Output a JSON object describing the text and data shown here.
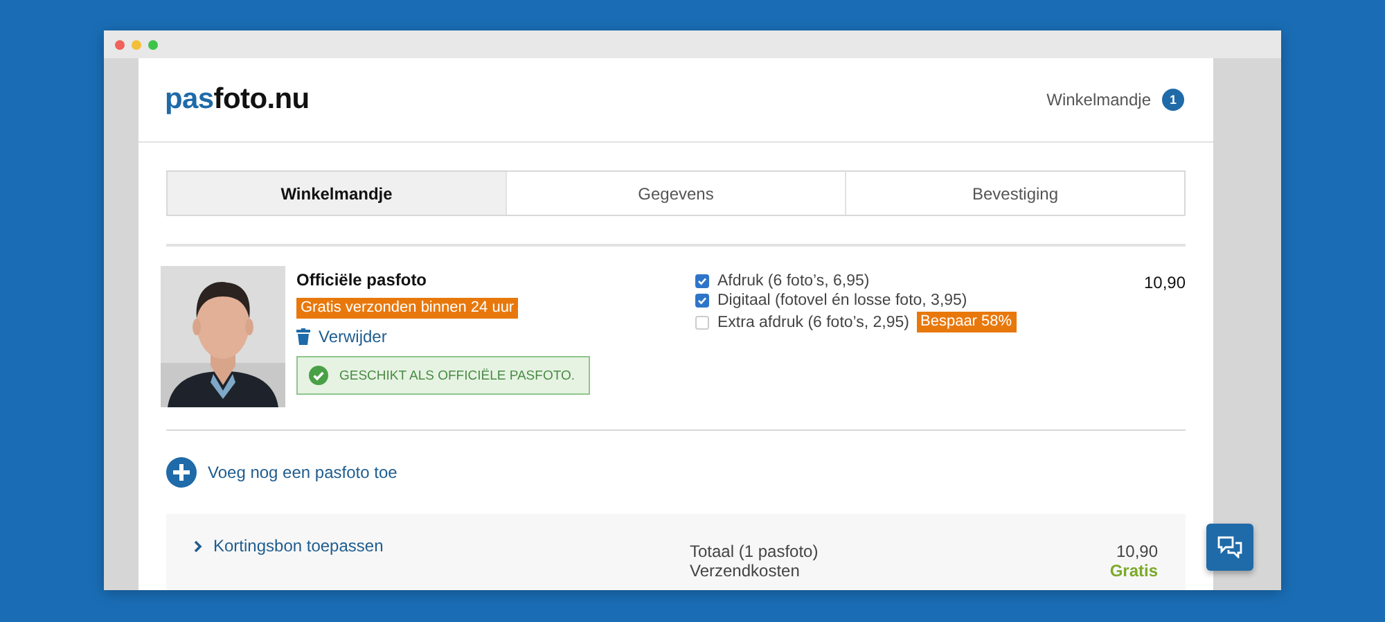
{
  "logo": {
    "prefix": "pas",
    "suffix": "foto.nu"
  },
  "cart_link": {
    "label": "Winkelmandje",
    "count": "1"
  },
  "steps": [
    {
      "label": "Winkelmandje",
      "selected": true
    },
    {
      "label": "Gegevens",
      "selected": false
    },
    {
      "label": "Bevestiging",
      "selected": false
    }
  ],
  "item": {
    "title": "Officiële pasfoto",
    "shipping_badge": "Gratis verzonden binnen 24 uur",
    "remove": "Verwijder",
    "approval": "GESCHIKT ALS OFFICIËLE PASFOTO.",
    "options": [
      {
        "label": "Afdruk (6 foto’s, 6,95)",
        "checked": true
      },
      {
        "label": "Digitaal (fotovel én losse foto, 3,95)",
        "checked": true
      },
      {
        "label": "Extra afdruk (6 foto’s, 2,95)",
        "checked": false,
        "badge": "Bespaar 58%"
      }
    ],
    "price": "10,90"
  },
  "add_photo": "Voeg nog een pasfoto toe",
  "coupon": "Kortingsbon toepassen",
  "summary": [
    {
      "label": "Totaal (1 pasfoto)",
      "value": "10,90",
      "kind": "plain"
    },
    {
      "label": "Verzendkosten",
      "value": "Gratis",
      "kind": "free"
    }
  ]
}
